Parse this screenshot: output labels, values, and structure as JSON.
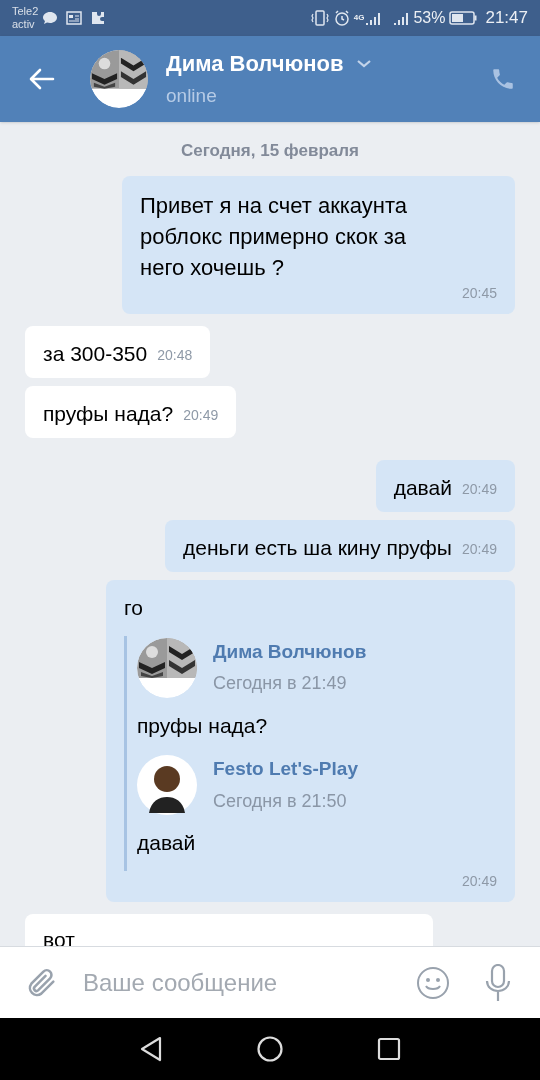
{
  "status_bar": {
    "carrier": "Tele2",
    "carrier_sub": "activ",
    "network": "4G",
    "battery": "53%",
    "time": "21:47"
  },
  "header": {
    "name": "Дима Волчюнов",
    "status": "online"
  },
  "date_divider": "Сегодня, 15 февраля",
  "messages": [
    {
      "kind": "out",
      "text": "Привет я на счет аккаунта роблокс примерно скок за него хочешь ?",
      "time": "20:45"
    },
    {
      "kind": "in",
      "text": "за 300-350",
      "time": "20:48"
    },
    {
      "kind": "in",
      "text": "пруфы нада?",
      "time": "20:49"
    },
    {
      "kind": "out",
      "text": "давай",
      "time": "20:49"
    },
    {
      "kind": "out",
      "text": "деньги есть ша кину пруфы",
      "time": "20:49"
    },
    {
      "kind": "out",
      "text": "го",
      "time": "20:49",
      "forwarded": [
        {
          "author": "Дима Волчюнов",
          "date": "Сегодня в 21:49",
          "text": "пруфы нада?",
          "kind": "picture"
        },
        {
          "author": "Festo Let's-Play",
          "date": "Сегодня в 21:50",
          "text": "давай",
          "kind": "avatar"
        }
      ]
    },
    {
      "kind": "in",
      "text": "вот"
    }
  ],
  "composer": {
    "placeholder": "Ваше сообщение"
  }
}
